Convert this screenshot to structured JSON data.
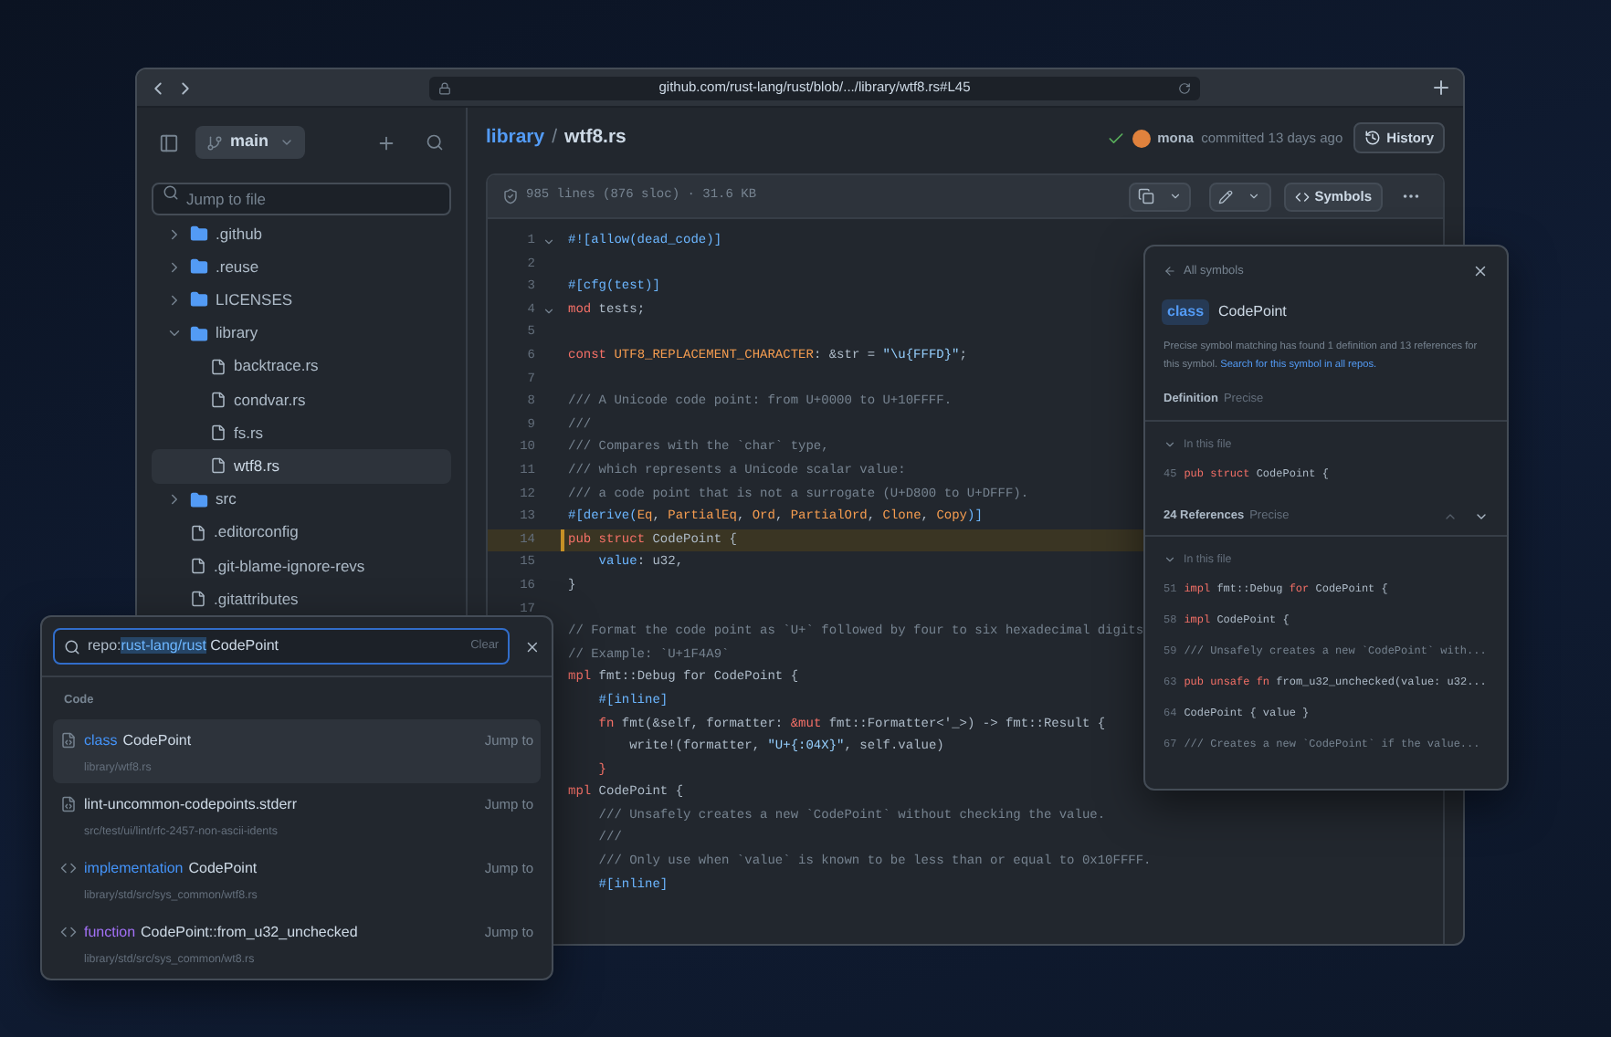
{
  "browser": {
    "url": "github.com/rust-lang/rust/blob/.../library/wtf8.rs#L45"
  },
  "sidebar": {
    "branch": "main",
    "search": {
      "placeholder": "Jump to file"
    },
    "tree": [
      {
        "name": ".github",
        "kind": "folder",
        "expanded": false,
        "selected": false
      },
      {
        "name": ".reuse",
        "kind": "folder",
        "expanded": false,
        "selected": false
      },
      {
        "name": "LICENSES",
        "kind": "folder",
        "expanded": false,
        "selected": false
      },
      {
        "name": "library",
        "kind": "folder",
        "expanded": true,
        "selected": false,
        "children": [
          {
            "name": "backtrace.rs",
            "kind": "file",
            "selected": false
          },
          {
            "name": "condvar.rs",
            "kind": "file",
            "selected": false
          },
          {
            "name": "fs.rs",
            "kind": "file",
            "selected": false
          },
          {
            "name": "wtf8.rs",
            "kind": "file",
            "selected": true
          }
        ]
      },
      {
        "name": "src",
        "kind": "folder",
        "expanded": false,
        "selected": false
      },
      {
        "name": ".editorconfig",
        "kind": "file",
        "selected": false
      },
      {
        "name": ".git-blame-ignore-revs",
        "kind": "file",
        "selected": false
      },
      {
        "name": ".gitattributes",
        "kind": "file",
        "selected": false
      }
    ]
  },
  "breadcrumb": {
    "folder": "library",
    "separator": "/",
    "file": "wtf8.rs"
  },
  "commit": {
    "author": "mona",
    "text": "committed 13 days ago",
    "button": "History"
  },
  "file": {
    "info": "985 lines (876 sloc) · 31.6 KB",
    "symbols_button": "Symbols",
    "lines": [
      {
        "number": "1",
        "fold": true,
        "highlighted": false,
        "tokens": [
          {
            "kind": "attr",
            "text": "#![allow(dead_code)]"
          }
        ]
      },
      {
        "number": "2",
        "fold": false,
        "highlighted": false
      },
      {
        "number": "3",
        "fold": false,
        "highlighted": false,
        "tokens": [
          {
            "kind": "attr",
            "text": "#[cfg(test)]"
          }
        ]
      },
      {
        "number": "4",
        "fold": true,
        "highlighted": false,
        "tokens": [
          {
            "kind": "kw",
            "text": "mod"
          },
          {
            "kind": "text",
            "text": " tests;"
          }
        ]
      },
      {
        "number": "5",
        "fold": false,
        "highlighted": false
      },
      {
        "number": "6",
        "fold": false,
        "highlighted": false,
        "tokens": [
          {
            "kind": "kw",
            "text": "const"
          },
          {
            "kind": "const",
            "text": " UTF8_REPLACEMENT_CHARACTER"
          },
          {
            "kind": "text",
            "text": ": &str = "
          },
          {
            "kind": "str",
            "text": "\"\\u{FFFD}\""
          },
          {
            "kind": "text",
            "text": ";"
          }
        ]
      },
      {
        "number": "7",
        "fold": false,
        "highlighted": false
      },
      {
        "number": "8",
        "fold": false,
        "highlighted": false,
        "tokens": [
          {
            "kind": "comment",
            "text": "/// A Unicode code point: from U+0000 to U+10FFFF."
          }
        ]
      },
      {
        "number": "9",
        "fold": false,
        "highlighted": false,
        "tokens": [
          {
            "kind": "comment",
            "text": "///"
          }
        ]
      },
      {
        "number": "10",
        "fold": false,
        "highlighted": false,
        "tokens": [
          {
            "kind": "comment",
            "text": "/// Compares with the `char` type,"
          }
        ]
      },
      {
        "number": "11",
        "fold": false,
        "highlighted": false,
        "tokens": [
          {
            "kind": "comment",
            "text": "/// which represents a Unicode scalar value:"
          }
        ]
      },
      {
        "number": "12",
        "fold": false,
        "highlighted": false,
        "tokens": [
          {
            "kind": "comment",
            "text": "/// a code point that is not a surrogate (U+D800 to U+DFFF)."
          }
        ]
      },
      {
        "number": "13",
        "fold": false,
        "highlighted": false,
        "tokens": [
          {
            "kind": "attr",
            "text": "#[derive("
          },
          {
            "kind": "const",
            "text": "Eq"
          },
          {
            "kind": "text",
            "text": ", "
          },
          {
            "kind": "const",
            "text": "PartialEq"
          },
          {
            "kind": "text",
            "text": ", "
          },
          {
            "kind": "const",
            "text": "Ord"
          },
          {
            "kind": "text",
            "text": ", "
          },
          {
            "kind": "const",
            "text": "PartialOrd"
          },
          {
            "kind": "text",
            "text": ", "
          },
          {
            "kind": "const",
            "text": "Clone"
          },
          {
            "kind": "text",
            "text": ", "
          },
          {
            "kind": "const",
            "text": "Copy"
          },
          {
            "kind": "attr",
            "text": ")]"
          }
        ]
      },
      {
        "number": "14",
        "fold": false,
        "highlighted": true,
        "tokens": [
          {
            "kind": "kw",
            "text": "pub"
          },
          {
            "kind": "kw",
            "text": " struct"
          },
          {
            "kind": "text",
            "text": " CodePoint {"
          }
        ]
      },
      {
        "number": "15",
        "fold": false,
        "highlighted": false,
        "tokens": [
          {
            "kind": "prop",
            "text": "    value"
          },
          {
            "kind": "text",
            "text": ": u32,"
          }
        ]
      },
      {
        "number": "16",
        "fold": false,
        "highlighted": false,
        "tokens": [
          {
            "kind": "text",
            "text": "}"
          }
        ]
      },
      {
        "number": "17",
        "fold": false,
        "highlighted": false
      },
      {
        "fold": false,
        "highlighted": false,
        "tokens": [
          {
            "kind": "comment",
            "text": "// Format the code point as `U+` followed by four to six hexadecimal digits"
          }
        ]
      },
      {
        "fold": false,
        "highlighted": false,
        "tokens": [
          {
            "kind": "comment",
            "text": "// Example: `U+1F4A9`"
          }
        ]
      },
      {
        "fold": false,
        "highlighted": false,
        "tokens": [
          {
            "kind": "kw",
            "text": "mpl"
          },
          {
            "kind": "text",
            "text": " fmt::Debug for CodePoint {"
          }
        ]
      },
      {
        "fold": false,
        "highlighted": false,
        "tokens": [
          {
            "kind": "attr",
            "text": "    #[inline]"
          }
        ]
      },
      {
        "fold": false,
        "highlighted": false,
        "tokens": [
          {
            "kind": "kw",
            "text": "    fn"
          },
          {
            "kind": "text",
            "text": " fmt(&self, formatter: "
          },
          {
            "kind": "kw",
            "text": "&mut"
          },
          {
            "kind": "text",
            "text": " fmt::Formatter<'_>) -> fmt::Result {"
          }
        ]
      },
      {
        "fold": false,
        "highlighted": false,
        "tokens": [
          {
            "kind": "text",
            "text": "        write!(formatter, "
          },
          {
            "kind": "str",
            "text": "\"U+{:04X}\""
          },
          {
            "kind": "text",
            "text": ", self.value)"
          }
        ]
      },
      {
        "fold": false,
        "highlighted": false,
        "tokens": [
          {
            "kind": "kw",
            "text": "    }"
          }
        ]
      },
      {
        "fold": false,
        "highlighted": false,
        "tokens": [
          {
            "kind": "kw",
            "text": "mpl"
          },
          {
            "kind": "text",
            "text": " CodePoint {"
          }
        ]
      },
      {
        "fold": false,
        "highlighted": false,
        "tokens": [
          {
            "kind": "comment",
            "text": "    /// Unsafely creates a new `CodePoint` without checking the value."
          }
        ]
      },
      {
        "fold": false,
        "highlighted": false,
        "tokens": [
          {
            "kind": "comment",
            "text": "    ///"
          }
        ]
      },
      {
        "fold": false,
        "highlighted": false,
        "tokens": [
          {
            "kind": "comment",
            "text": "    /// Only use when `value` is known to be less than or equal to 0x10FFFF."
          }
        ]
      },
      {
        "fold": false,
        "highlighted": false,
        "tokens": [
          {
            "kind": "attr",
            "text": "    #[inline]"
          }
        ]
      }
    ]
  },
  "symbol_panel": {
    "back": "All symbols",
    "badge": "class",
    "name": "CodePoint",
    "description": "Precise symbol matching has found 1 definition and 13 references for this symbol.",
    "link": "Search for this symbol in all repos.",
    "definition": {
      "title": "Definition",
      "tag": "Precise",
      "group": "In this file",
      "lines": [
        {
          "number": "45",
          "tokens": [
            {
              "kind": "kw",
              "text": "pub"
            },
            {
              "kind": "kw",
              "text": " struct"
            },
            {
              "kind": "text",
              "text": " CodePoint {"
            }
          ]
        }
      ]
    },
    "references": {
      "title": "24 References",
      "tag": "Precise",
      "group": "In this file",
      "lines": [
        {
          "number": "51",
          "tokens": [
            {
              "kind": "kw",
              "text": "impl"
            },
            {
              "kind": "text",
              "text": " fmt::Debug "
            },
            {
              "kind": "kw",
              "text": "for"
            },
            {
              "kind": "text",
              "text": " CodePoint {"
            }
          ]
        },
        {
          "number": "58",
          "tokens": [
            {
              "kind": "kw",
              "text": "impl"
            },
            {
              "kind": "text",
              "text": " CodePoint {"
            }
          ]
        },
        {
          "number": "59",
          "tokens": [
            {
              "kind": "comment",
              "text": "/// Unsafely creates a new `CodePoint` with..."
            }
          ]
        },
        {
          "number": "63",
          "tokens": [
            {
              "kind": "kw",
              "text": "pub"
            },
            {
              "kind": "kw",
              "text": " unsafe"
            },
            {
              "kind": "kw",
              "text": " fn"
            },
            {
              "kind": "text",
              "text": " from_u32_unchecked(value: u32..."
            }
          ]
        },
        {
          "number": "64",
          "tokens": [
            {
              "kind": "text",
              "text": "CodePoint { value }"
            }
          ]
        },
        {
          "number": "67",
          "tokens": [
            {
              "kind": "comment",
              "text": "/// Creates a new `CodePoint` if the value..."
            }
          ]
        }
      ]
    }
  },
  "search_popup": {
    "query_prefix": "repo:",
    "query_scope": "rust-lang/rust",
    "query_term": "CodePoint",
    "clear": "Clear",
    "section": "Code",
    "results": [
      {
        "kind": "file",
        "prefix": "class",
        "color": "#4493f8",
        "name": "CodePoint",
        "path": "library/wtf8.rs",
        "action": "Jump to",
        "selected": true
      },
      {
        "kind": "file",
        "name": "lint-uncommon-codepoints.stderr",
        "path": "src/test/ui/lint/rfc-2457-non-ascii-idents",
        "action": "Jump to",
        "selected": false
      },
      {
        "kind": "code",
        "prefix": "implementation",
        "color": "#4493f8",
        "name": "CodePoint",
        "path": "library/std/src/sys_common/wtf8.rs",
        "action": "Jump to",
        "selected": false
      },
      {
        "kind": "code",
        "prefix": "function",
        "color": "#a371f7",
        "name": "CodePoint::from_u32_unchecked",
        "path": "library/std/src/sys_common/wt8.rs",
        "action": "Jump to",
        "selected": false
      }
    ]
  }
}
